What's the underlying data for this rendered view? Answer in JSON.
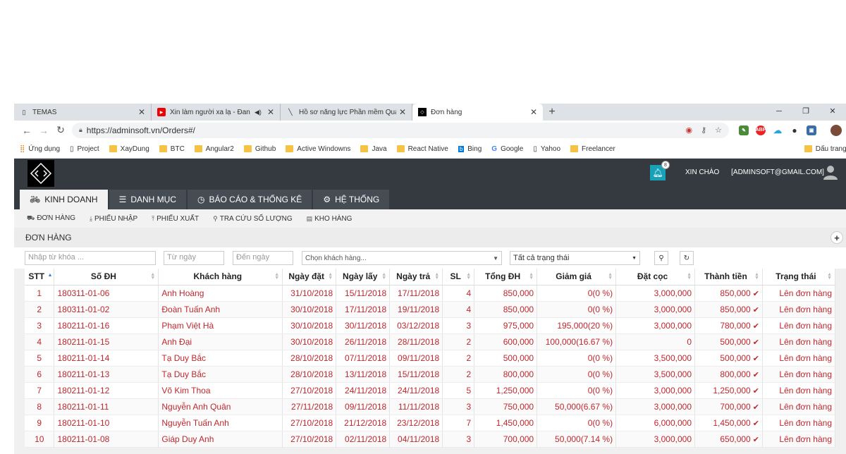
{
  "browser": {
    "tabs": [
      {
        "title": "TEMAS",
        "icon": "page-icon"
      },
      {
        "title": "Xin làm người xa lạ - Đan Ng",
        "icon": "youtube-icon"
      },
      {
        "title": "Hồ sơ năng lực Phần mềm Quản",
        "icon": "page-icon"
      },
      {
        "title": "Đơn hàng",
        "icon": "site-icon"
      }
    ],
    "url": "https://adminsoft.vn/Orders#/",
    "bookmarks": [
      "Ứng dụng",
      "Project",
      "XayDung",
      "BTC",
      "Angular2",
      "Github",
      "Active Windowns",
      "Java",
      "React Native",
      "Bing",
      "Google",
      "Yahoo",
      "Freelancer"
    ],
    "bookmark_last": "Dấu trang kh"
  },
  "app": {
    "notification_count": "8",
    "greeting": "XIN CHÀO",
    "user": "[ADMINSOFT@GMAIL.COM]",
    "main_tabs": [
      "KINH DOANH",
      "DANH MỤC",
      "BÁO CÁO & THỐNG KÊ",
      "HỆ THỐNG"
    ],
    "sub_tabs": [
      "ĐƠN HÀNG",
      "PHIẾU NHẬP",
      "PHIẾU XUẤT",
      "TRA CỨU SỐ LƯỢNG",
      "KHO HÀNG"
    ],
    "section_title": "ĐƠN HÀNG",
    "filters": {
      "keyword_placeholder": "Nhập từ khóa ...",
      "from_placeholder": "Từ ngày",
      "to_placeholder": "Đến ngày",
      "customer": "Chọn khách hàng...",
      "status": "Tất cả trạng thái"
    },
    "columns": [
      "STT",
      "Số ĐH",
      "Khách hàng",
      "Ngày đặt",
      "Ngày lấy",
      "Ngày trả",
      "SL",
      "Tổng ĐH",
      "Giảm giá",
      "Đặt cọc",
      "Thành tiền",
      "Trạng thái"
    ],
    "rows": [
      [
        "1",
        "180311-01-06",
        "Anh Hoàng",
        "31/10/2018",
        "15/11/2018",
        "17/11/2018",
        "4",
        "850,000",
        "0(0 %)",
        "3,000,000",
        "850,000",
        "Lên đơn hàng"
      ],
      [
        "2",
        "180311-01-02",
        "Đoàn Tuấn Anh",
        "30/10/2018",
        "17/11/2018",
        "19/11/2018",
        "4",
        "850,000",
        "0(0 %)",
        "3,000,000",
        "850,000",
        "Lên đơn hàng"
      ],
      [
        "3",
        "180211-01-16",
        "Phạm Việt Hà",
        "30/10/2018",
        "30/11/2018",
        "03/12/2018",
        "3",
        "975,000",
        "195,000(20 %)",
        "3,000,000",
        "780,000",
        "Lên đơn hàng"
      ],
      [
        "4",
        "180211-01-15",
        "Anh Đại",
        "30/10/2018",
        "26/11/2018",
        "28/11/2018",
        "2",
        "600,000",
        "100,000(16.67 %)",
        "0",
        "500,000",
        "Lên đơn hàng"
      ],
      [
        "5",
        "180211-01-14",
        "Tạ Duy Bắc",
        "28/10/2018",
        "07/11/2018",
        "09/11/2018",
        "2",
        "500,000",
        "0(0 %)",
        "3,500,000",
        "500,000",
        "Lên đơn hàng"
      ],
      [
        "6",
        "180211-01-13",
        "Tạ Duy Bắc",
        "28/10/2018",
        "13/11/2018",
        "15/11/2018",
        "2",
        "800,000",
        "0(0 %)",
        "3,500,000",
        "800,000",
        "Lên đơn hàng"
      ],
      [
        "7",
        "180211-01-12",
        "Võ Kim Thoa",
        "27/10/2018",
        "24/11/2018",
        "24/11/2018",
        "5",
        "1,250,000",
        "0(0 %)",
        "3,000,000",
        "1,250,000",
        "Lên đơn hàng"
      ],
      [
        "8",
        "180211-01-11",
        "Nguyễn Anh Quân",
        "27/11/2018",
        "09/11/2018",
        "11/11/2018",
        "3",
        "750,000",
        "50,000(6.67 %)",
        "3,000,000",
        "700,000",
        "Lên đơn hàng"
      ],
      [
        "9",
        "180211-01-10",
        "Nguyễn Tuấn Anh",
        "27/10/2018",
        "21/12/2018",
        "23/12/2018",
        "7",
        "1,450,000",
        "0(0 %)",
        "6,000,000",
        "1,450,000",
        "Lên đơn hàng"
      ],
      [
        "10",
        "180211-01-08",
        "Giáp Duy Anh",
        "27/10/2018",
        "02/11/2018",
        "04/11/2018",
        "3",
        "700,000",
        "50,000(7.14 %)",
        "3,000,000",
        "650,000",
        "Lên đơn hàng"
      ]
    ]
  }
}
